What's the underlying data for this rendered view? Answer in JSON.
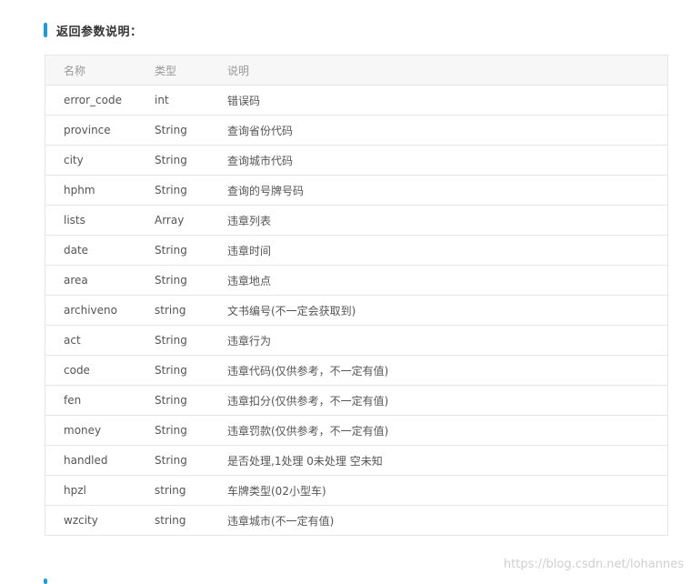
{
  "section": {
    "title": "返回参数说明："
  },
  "table": {
    "headers": {
      "name": "名称",
      "type": "类型",
      "desc": "说明"
    },
    "rows": [
      {
        "name": "error_code",
        "type": "int",
        "desc": "错误码"
      },
      {
        "name": "province",
        "type": "String",
        "desc": "查询省份代码"
      },
      {
        "name": "city",
        "type": "String",
        "desc": "查询城市代码"
      },
      {
        "name": "hphm",
        "type": "String",
        "desc": "查询的号牌号码"
      },
      {
        "name": "lists",
        "type": "Array",
        "desc": "违章列表"
      },
      {
        "name": "date",
        "type": "String",
        "desc": "违章时间"
      },
      {
        "name": "area",
        "type": "String",
        "desc": "违章地点"
      },
      {
        "name": "archiveno",
        "type": "string",
        "desc": "文书编号(不一定会获取到)"
      },
      {
        "name": "act",
        "type": "String",
        "desc": "违章行为"
      },
      {
        "name": "code",
        "type": "String",
        "desc": "违章代码(仅供参考，不一定有值)"
      },
      {
        "name": "fen",
        "type": "String",
        "desc": "违章扣分(仅供参考，不一定有值)"
      },
      {
        "name": "money",
        "type": "String",
        "desc": "违章罚款(仅供参考，不一定有值)"
      },
      {
        "name": "handled",
        "type": "String",
        "desc": "是否处理,1处理 0未处理 空未知"
      },
      {
        "name": "hpzl",
        "type": "string",
        "desc": "车牌类型(02小型车)"
      },
      {
        "name": "wzcity",
        "type": "string",
        "desc": "违章城市(不一定有值)"
      }
    ]
  },
  "watermark": "https://blog.csdn.net/lohannes",
  "colors": {
    "accent": "#1a9dd9",
    "header_bg": "#f7f7f7",
    "border": "#e6e6e6"
  }
}
